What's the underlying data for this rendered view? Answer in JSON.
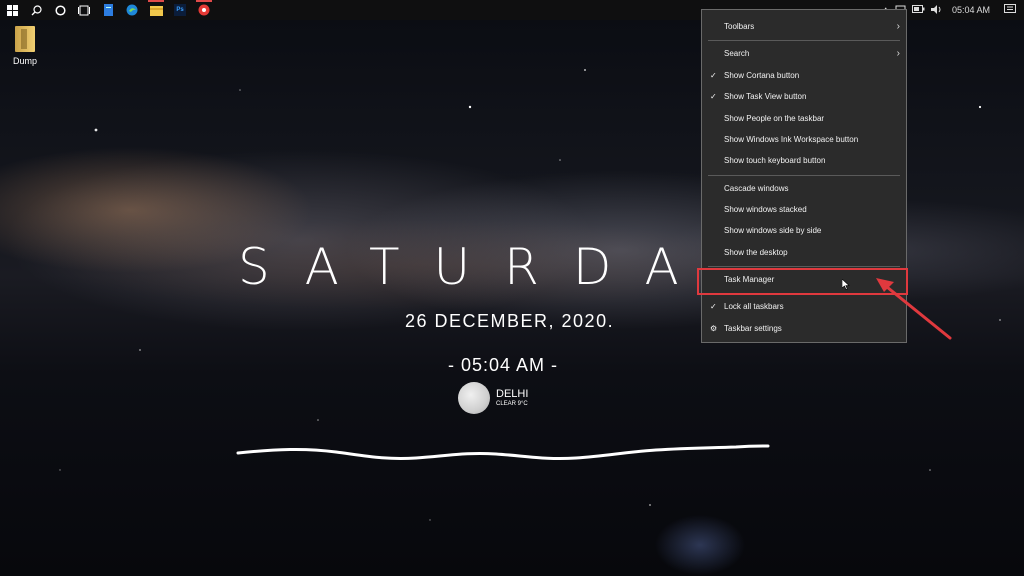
{
  "desktop": {
    "icon_label": "Dump"
  },
  "taskbar": {
    "clock": "05:04 AM",
    "icons": [
      "windows-start-icon",
      "search-icon",
      "cortana-icon",
      "task-view-icon",
      "file-icon",
      "edge-icon",
      "file-explorer-icon",
      "photoshop-icon",
      "media-player-icon"
    ],
    "photoshop_label": "Ps"
  },
  "widget": {
    "day": "SATURDA",
    "date": "26 DECEMBER, 2020.",
    "time": "- 05:04 AM -",
    "city": "DELHI",
    "condition": "CLEAR 9°C"
  },
  "context_menu": {
    "items": [
      {
        "label": "Toolbars",
        "submenu": true
      },
      {
        "label": "Search",
        "submenu": true
      },
      {
        "label": "Show Cortana button",
        "checked": true
      },
      {
        "label": "Show Task View button",
        "checked": true
      },
      {
        "label": "Show People on the taskbar"
      },
      {
        "label": "Show Windows Ink Workspace button"
      },
      {
        "label": "Show touch keyboard button"
      },
      {
        "label": "Cascade windows"
      },
      {
        "label": "Show windows stacked"
      },
      {
        "label": "Show windows side by side"
      },
      {
        "label": "Show the desktop"
      },
      {
        "label": "Task Manager",
        "highlighted": true
      },
      {
        "label": "Lock all taskbars",
        "checked": true
      },
      {
        "label": "Taskbar settings"
      }
    ]
  },
  "colors": {
    "highlight_border": "#e0393e",
    "menu_bg": "#2b2b2b",
    "taskbar_bg": "#0f0f10"
  }
}
